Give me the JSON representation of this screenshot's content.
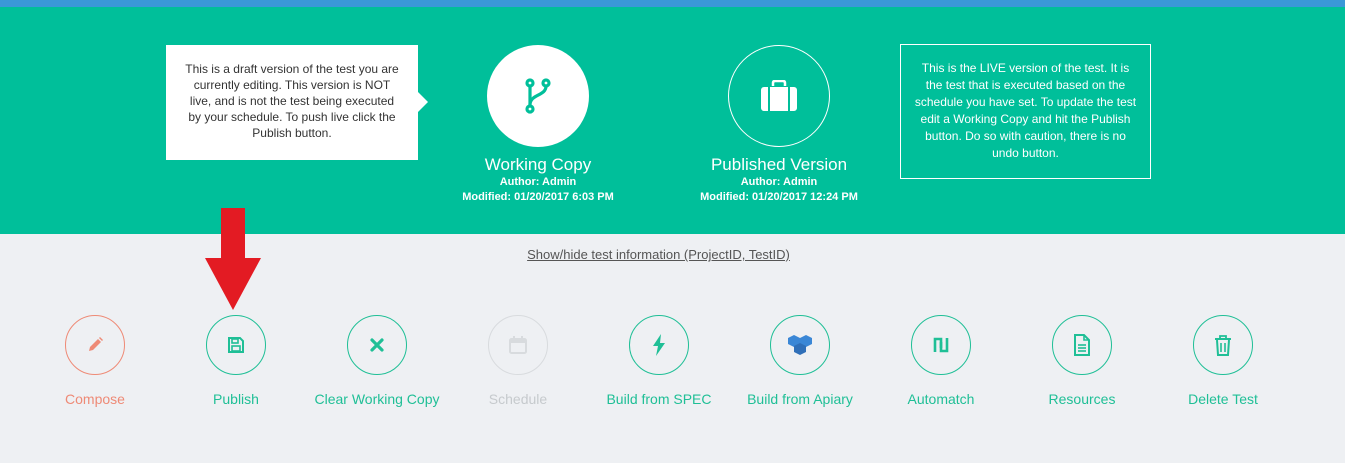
{
  "header": {
    "draft_note": "This is a draft version of the test you are currently editing. This version is NOT live, and is not the test being executed by your schedule. To push live click the Publish button.",
    "live_note": "This is the LIVE version of the test. It is the test that is executed based on the schedule you have set. To update the test edit a Working Copy and hit the Publish button. Do so with caution, there is no undo button.",
    "working": {
      "title": "Working Copy",
      "author": "Author: Admin",
      "modified": "Modified: 01/20/2017 6:03 PM",
      "icon": "branch-icon"
    },
    "published": {
      "title": "Published Version",
      "author": "Author: Admin",
      "modified": "Modified: 01/20/2017 12:24 PM",
      "icon": "briefcase-icon"
    }
  },
  "info_link": "Show/hide test information (ProjectID, TestID)",
  "actions": [
    {
      "label": "Compose",
      "icon": "pencil-icon",
      "state": "warning"
    },
    {
      "label": "Publish",
      "icon": "save-icon",
      "state": "enabled"
    },
    {
      "label": "Clear Working Copy",
      "icon": "x-icon",
      "state": "enabled"
    },
    {
      "label": "Schedule",
      "icon": "calendar-icon",
      "state": "disabled"
    },
    {
      "label": "Build from SPEC",
      "icon": "bolt-icon",
      "state": "enabled"
    },
    {
      "label": "Build from Apiary",
      "icon": "apiary-icon",
      "state": "enabled"
    },
    {
      "label": "Automatch",
      "icon": "automatch-icon",
      "state": "enabled"
    },
    {
      "label": "Resources",
      "icon": "document-icon",
      "state": "enabled"
    },
    {
      "label": "Delete Test",
      "icon": "trash-icon",
      "state": "enabled"
    }
  ],
  "colors": {
    "hero": "#00bf9a",
    "accent": "#1fbf96",
    "compose": "#ee8a76",
    "disabled": "#c6cacd",
    "arrow": "#e31b23",
    "topbar": "#3a98d8"
  }
}
